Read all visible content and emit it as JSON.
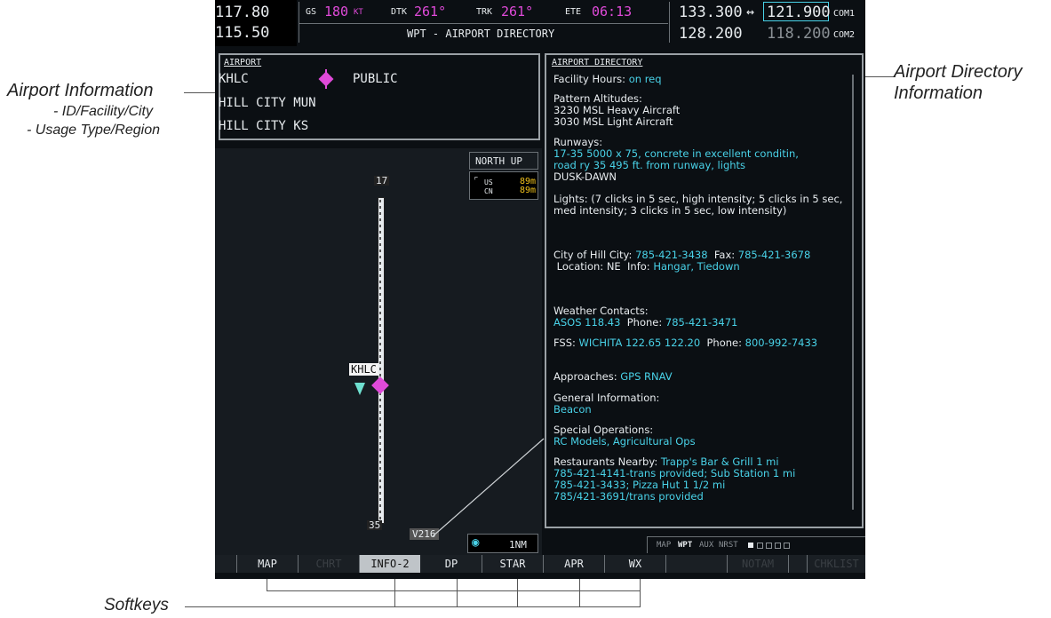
{
  "callouts": {
    "airport_info_title": "Airport Information",
    "airport_info_sub1": "- ID/Facility/City",
    "airport_info_sub2": "- Usage Type/Region",
    "directory_line1": "Airport Directory",
    "directory_line2": "Information",
    "softkeys": "Softkeys"
  },
  "nav_status": {
    "nav1": "117.80",
    "nav2": "115.50",
    "gs_label": "GS",
    "gs_value": "180",
    "gs_unit": "KT",
    "dtk_label": "DTK",
    "dtk_value": "261°",
    "trk_label": "TRK",
    "trk_value": "261°",
    "ete_label": "ETE",
    "ete_value": "06:13",
    "page_title": "WPT - AIRPORT DIRECTORY"
  },
  "com": {
    "com1_active": "133.300",
    "swap_arrow": "↔",
    "com1_standby": "121.900",
    "com1_label": "COM1",
    "com2_active": "128.200",
    "com2_standby": "118.200",
    "com2_label": "COM2"
  },
  "airport": {
    "header": "AIRPORT",
    "id": "KHLC",
    "usage": "PUBLIC",
    "facility": "HILL CITY MUN",
    "city": "HILL CITY KS"
  },
  "map": {
    "orientation": "NORTH UP",
    "wind_us_label": "US",
    "wind_us_value": "89m",
    "wind_cn_label": "CN",
    "wind_cn_value": "89m",
    "runway_top": "17",
    "runway_bottom": "35",
    "airport_label": "KHLC",
    "airway": "V216",
    "range": "1NM"
  },
  "directory": {
    "header": "AIRPORT DIRECTORY",
    "facility_hours_label": "Facility Hours:",
    "facility_hours_value": "on req",
    "pattern_label": "Pattern Altitudes:",
    "pattern_line1": "3230 MSL Heavy Aircraft",
    "pattern_line2": "3030 MSL Light Aircraft",
    "runways_label": "Runways:",
    "runways_line1": "17-35 5000 x 75,",
    "runways_line1b": "concrete in excellent conditin,",
    "runways_line2": "road ry 35   495 ft. from runway, lights",
    "runways_line3": "DUSK-DAWN",
    "lights_label": "Lights:",
    "lights_text": "(7 clicks in 5 sec, high intensity; 5 clicks in 5 sec, med intensity; 3 clicks in 5 sec, low intensity)",
    "city_label": "City of Hill City:",
    "city_phone": "785-421-3438",
    "fax_label": "Fax:",
    "fax_value": "785-421-3678",
    "location_label": "Location:",
    "location_value": "NE",
    "info_label": "Info:",
    "info_value": "Hangar, Tiedown",
    "weather_label": "Weather Contacts:",
    "asos": "ASOS 118.43",
    "asos_phone_label": "Phone:",
    "asos_phone": "785-421-3471",
    "fss_label": "FSS:",
    "fss_value": "WICHITA 122.65 122.20",
    "fss_phone_label": "Phone:",
    "fss_phone": "800-992-7433",
    "approaches_label": "Approaches:",
    "approaches_value": "GPS RNAV",
    "general_label": "General Information:",
    "general_value": "Beacon",
    "special_label": "Special Operations:",
    "special_value": "RC Models, Agricultural Ops",
    "restaurants_label": "Restaurants Nearby:",
    "restaurants_line1": "Trapp's Bar & Grill 1 mi",
    "restaurants_line2": "785-421-4141-trans provided; Sub Station 1 mi",
    "restaurants_line3": "785-421-3433; Pizza Hut 1 1/2 mi",
    "restaurants_line4": "785/421-3691/trans provided"
  },
  "page_groups": {
    "map": "MAP",
    "wpt": "WPT",
    "aux": "AUX",
    "nrst": "NRST"
  },
  "softkeys": [
    "",
    "MAP",
    "CHRT",
    "INFO-2",
    "DP",
    "STAR",
    "APR",
    "WX",
    "",
    "NOTAM",
    "",
    "CHKLIST"
  ]
}
